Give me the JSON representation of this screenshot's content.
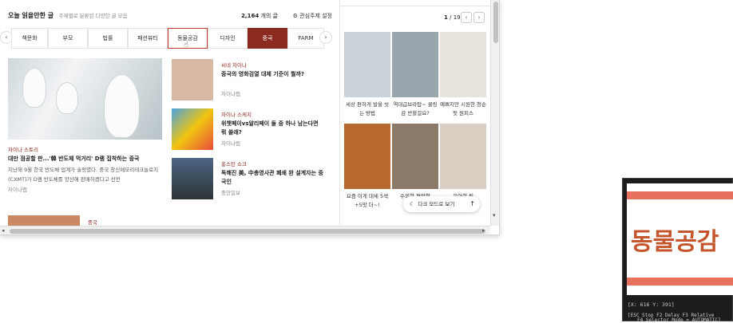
{
  "header": {
    "title": "오늘 읽을만한 글",
    "subtitle": "주제별로 분류된 다양한 글 모음",
    "count_number": "2,164",
    "count_suffix": "개의 글",
    "settings_label": "관심주제 설정"
  },
  "tabs": [
    {
      "label": "책문화"
    },
    {
      "label": "부모"
    },
    {
      "label": "법률"
    },
    {
      "label": "패션뷰티"
    },
    {
      "label": "동물공감"
    },
    {
      "label": "디자인"
    },
    {
      "label": "중국"
    },
    {
      "label": "FARM"
    }
  ],
  "main_story": {
    "category": "차이나 스토리",
    "title": "대만 점공할 판...'韓 반도체 먹거리' D램 집착하는 중국",
    "body": "지난해 9월 한국 반도체 업계가 술렁였다. 중국 창신메모리테크놀로지(CXMT)가 D램 반도체를 양산해 판매하겠다고 선언",
    "source": "차이나랩"
  },
  "side_stories": [
    {
      "category": "씨네 차이나",
      "title": "중국의 영화검열 대체 기준이 뭘까?",
      "source": "차이나랩"
    },
    {
      "category": "차이나 스케치",
      "title": "위챗페이vs알리페이 둘 중 하나 남는다면 뭐 쓸래?",
      "source": "차이나랩"
    },
    {
      "category": "홍스턴 쇼크",
      "title": "독해진 美, 中총영사관 폐쇄 완 설계자는 중국인",
      "source": "중앙일보"
    }
  ],
  "bottom_story": {
    "category": "중국"
  },
  "right_panel": {
    "page_current": "1",
    "page_sep": "/",
    "page_total": "19",
    "items": [
      {
        "caption": "세상 편하게 발을 씻는 방법",
        "color": "#c9d2d8"
      },
      {
        "caption": "역대급브라탑~ 쿨링감 반할걸요?",
        "color": "#9aa6ad"
      },
      {
        "caption": "예쁘지만 시원한 청순핏 원피스",
        "color": "#e8e2dc"
      },
      {
        "caption": "요즘 이게 대세 5색+5맛 더~!",
        "color": "#b8692e"
      },
      {
        "caption": "수외한 편안함",
        "color": "#8c7a68"
      },
      {
        "caption": "우아한 핏",
        "color": "#d9cfc3"
      }
    ],
    "dark_mode_label": "다크 모드로 보기",
    "top_icon": "up-arrow-icon"
  },
  "dev_overlay": {
    "zoom_text": "동물공감",
    "coords": "[X: 616 Y: 391]",
    "hint1": "[ESC Stop  F2 Delay  F3 Relative",
    "hint2": "F4 Selector Mode = AUTOMATIC]"
  },
  "colors": {
    "accent": "#8b2a1f",
    "highlight_border": "#c0392b"
  }
}
